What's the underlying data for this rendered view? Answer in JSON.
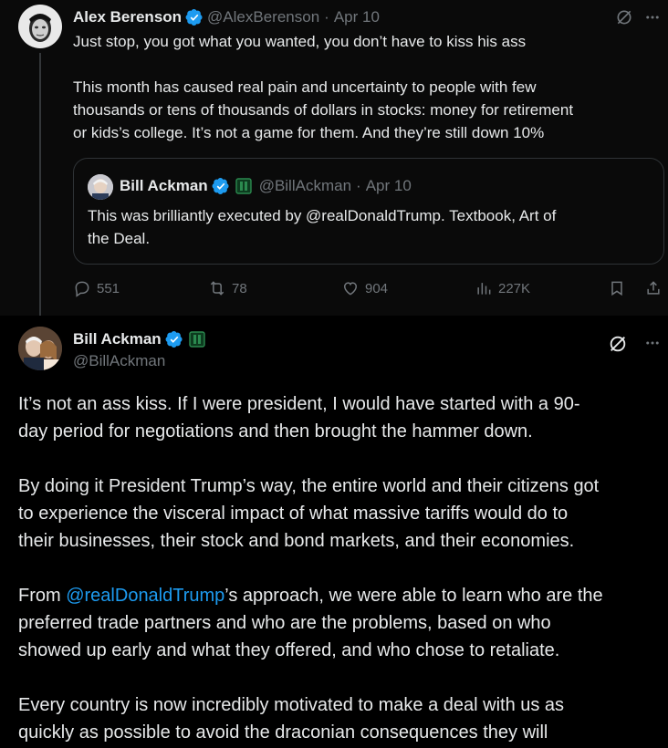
{
  "reply": {
    "author_name": "Alex Berenson",
    "handle": "@AlexBerenson",
    "separator": "·",
    "date": "Apr 10",
    "line1": "Just stop, you got what you wanted, you don’t have to kiss his ass",
    "para2": [
      "This month has caused real pain and uncertainty to people with few",
      "thousands or tens of thousands of dollars in stocks: money for retirement",
      "or kids’s college. It’s not a game for them. And they’re still down 10%"
    ],
    "quote": {
      "author_name": "Bill Ackman",
      "handle": "@BillAckman",
      "separator": "·",
      "date": "Apr 10",
      "lines": [
        "This was brilliantly executed by @realDonaldTrump. Textbook, Art of",
        "the Deal."
      ]
    },
    "actions": {
      "replies": "551",
      "reposts": "78",
      "likes": "904",
      "views": "227K"
    }
  },
  "main": {
    "author_name": "Bill Ackman",
    "handle": "@BillAckman",
    "para1": [
      "It’s not an ass kiss. If I were president, I would have started with a 90-",
      "day period for negotiations and then brought the hammer down."
    ],
    "para2": [
      "By doing it President Trump’s way, the entire world and their citizens got",
      "to experience the visceral impact of what massive tariffs would do to",
      "their businesses, their stock and bond markets, and their economies."
    ],
    "para3_prefix": "From ",
    "para3_mention": "@realDonaldTrump",
    "para3_line1_rest": "’s approach, we were able to learn who are the",
    "para3_rest": [
      "preferred trade partners and who are the problems, based on who",
      "showed up early and what they offered, and who chose to retaliate."
    ],
    "para4": [
      "Every country is now incredibly motivated to make a deal with us as",
      "quickly as possible to avoid the draconian consequences they will"
    ]
  },
  "colors": {
    "accent": "#1d9bf0",
    "text": "#e7e9ea",
    "muted": "#71767b",
    "border": "#2f3336"
  },
  "icons": [
    "verified-badge-icon",
    "affiliate-badge-icon",
    "grok-icon",
    "more-icon",
    "reply-icon",
    "repost-icon",
    "like-icon",
    "views-icon",
    "bookmark-icon",
    "share-icon"
  ]
}
